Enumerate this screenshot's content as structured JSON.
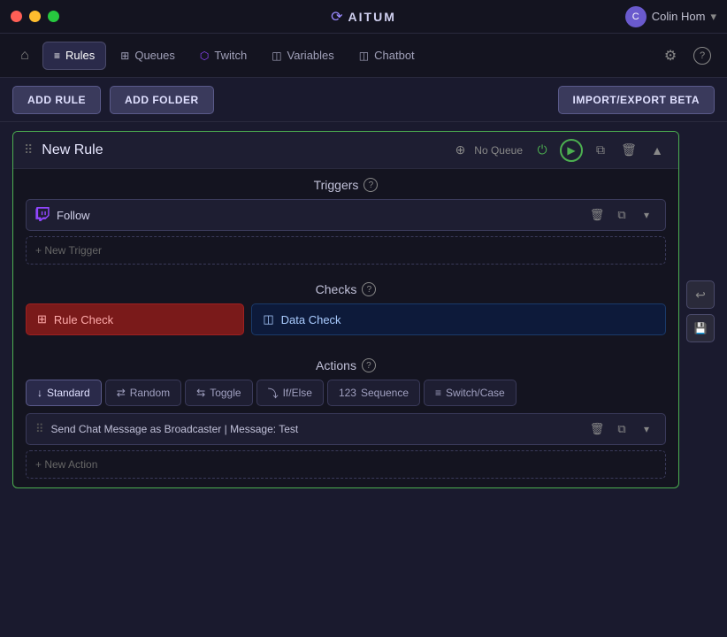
{
  "titlebar": {
    "app_name": "AITUM",
    "user_name": "Colin Hom",
    "chevron": "▾"
  },
  "navbar": {
    "home_icon": "⌂",
    "items": [
      {
        "id": "rules",
        "label": "Rules",
        "icon": "≡",
        "active": true
      },
      {
        "id": "queues",
        "label": "Queues",
        "icon": "⊞",
        "active": false
      },
      {
        "id": "twitch",
        "label": "Twitch",
        "icon": "⬡",
        "active": false
      },
      {
        "id": "variables",
        "label": "Variables",
        "icon": "◫",
        "active": false
      },
      {
        "id": "chatbot",
        "label": "Chatbot",
        "icon": "◫",
        "active": false
      }
    ],
    "settings_icon": "⚙",
    "help_icon": "?"
  },
  "toolbar": {
    "add_rule_label": "ADD RULE",
    "add_folder_label": "ADD FOLDER",
    "import_export_label": "IMPORT/EXPORT BETA"
  },
  "rule": {
    "drag_handle": "⠿",
    "title": "New Rule",
    "queue_label": "No Queue",
    "controls": {
      "stacked_icon": "⊕",
      "power_icon": "⏻",
      "play_icon": "▶",
      "copy_icon": "⧉",
      "delete_icon": "🗑",
      "collapse_icon": "▲"
    },
    "triggers_section": {
      "label": "Triggers",
      "help": "?",
      "trigger_item": {
        "icon": "🔔",
        "label": "Follow",
        "delete_icon": "🗑",
        "copy_icon": "⧉",
        "chevron": "▾"
      },
      "new_trigger_label": "+ New Trigger"
    },
    "checks_section": {
      "label": "Checks",
      "help": "?",
      "rule_check_icon": "⊞",
      "rule_check_label": "Rule Check",
      "data_check_icon": "◫",
      "data_check_label": "Data Check"
    },
    "actions_section": {
      "label": "Actions",
      "help": "?",
      "tabs": [
        {
          "id": "standard",
          "icon": "↓",
          "label": "Standard",
          "active": true
        },
        {
          "id": "random",
          "icon": "⇄",
          "label": "Random",
          "active": false
        },
        {
          "id": "toggle",
          "icon": "⇆",
          "label": "Toggle",
          "active": false
        },
        {
          "id": "ifelse",
          "icon": "⤵",
          "label": "If/Else",
          "active": false
        },
        {
          "id": "sequence",
          "icon": "123",
          "label": "Sequence",
          "active": false
        },
        {
          "id": "switchcase",
          "icon": "≡",
          "label": "Switch/Case",
          "active": false
        }
      ],
      "action_item": {
        "drag_handle": "⠿",
        "label": "Send Chat Message as Broadcaster | Message: Test",
        "delete_icon": "🗑",
        "copy_icon": "⧉",
        "chevron": "▾"
      },
      "new_action_label": "+ New Action"
    }
  },
  "side_buttons": {
    "undo_icon": "↩",
    "save_icon": "💾"
  }
}
